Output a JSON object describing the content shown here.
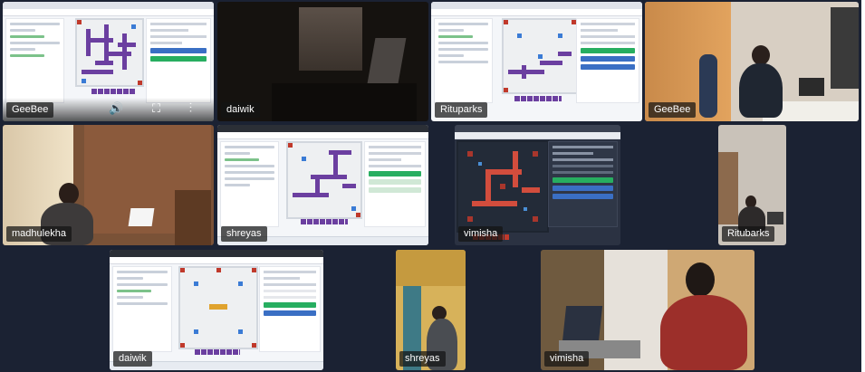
{
  "participants": [
    {
      "id": "t1",
      "name": "GeeBee",
      "view": "screen"
    },
    {
      "id": "t2",
      "name": "daiwik",
      "view": "camera"
    },
    {
      "id": "t3",
      "name": "Rituparks",
      "view": "screen"
    },
    {
      "id": "t4",
      "name": "GeeBee",
      "view": "camera"
    },
    {
      "id": "t5",
      "name": "madhulekha",
      "view": "camera"
    },
    {
      "id": "t6",
      "name": "shreyas",
      "view": "screen"
    },
    {
      "id": "t7",
      "name": "vimisha",
      "view": "screen"
    },
    {
      "id": "t8",
      "name": "Ritubarks",
      "view": "camera"
    },
    {
      "id": "t9",
      "name": "daiwik",
      "view": "screen"
    },
    {
      "id": "t10",
      "name": "shreyas",
      "view": "camera"
    },
    {
      "id": "t11",
      "name": "vimisha",
      "view": "camera"
    }
  ],
  "controls": {
    "icons": [
      "volume-icon",
      "fullscreen-icon",
      "more-options-icon"
    ],
    "glyphs": "🔊 ⛶ ⋮"
  },
  "colors": {
    "background": "#1b2233",
    "board_purple": "#6b3fa0",
    "board_red": "#c0392b",
    "accent_green": "#27ae60"
  }
}
